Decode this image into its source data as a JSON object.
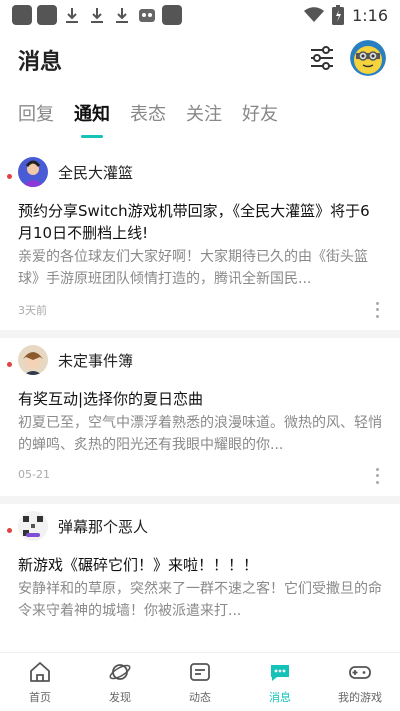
{
  "status_bar": {
    "time": "1:16"
  },
  "header": {
    "title": "消息"
  },
  "tabs": [
    {
      "label": "回复",
      "active": false
    },
    {
      "label": "通知",
      "active": true
    },
    {
      "label": "表态",
      "active": false
    },
    {
      "label": "关注",
      "active": false
    },
    {
      "label": "好友",
      "active": false
    }
  ],
  "notifications": [
    {
      "sender": "全民大灌篮",
      "title": "预约分享Switch游戏机带回家，《全民大灌篮》将于6月10日不删档上线!",
      "body": "亲爱的各位球友们大家好啊！大家期待已久的由《街头篮球》手游原班团队倾情打造的，腾讯全新国民...",
      "date": "3天前",
      "unread": true
    },
    {
      "sender": "未定事件簿",
      "title": "有奖互动|选择你的夏日恋曲",
      "body": "初夏已至，空气中漂浮着熟悉的浪漫味道。微热的风、轻悄的蝉鸣、炙热的阳光还有我眼中耀眼的你...",
      "date": "05-21",
      "unread": true
    },
    {
      "sender": "弹幕那个恶人",
      "title": "新游戏《碾碎它们！》来啦！！！！",
      "body": "安静祥和的草原，突然来了一群不速之客！它们受撒旦的命令来守着神的城墙！你被派遣来打...",
      "date": "",
      "unread": true
    }
  ],
  "bottom_nav": [
    {
      "label": "首页",
      "icon": "home-icon",
      "active": false
    },
    {
      "label": "发现",
      "icon": "planet-icon",
      "active": false
    },
    {
      "label": "动态",
      "icon": "feed-icon",
      "active": false
    },
    {
      "label": "消息",
      "icon": "message-icon",
      "active": true
    },
    {
      "label": "我的游戏",
      "icon": "gamepad-icon",
      "active": false
    }
  ],
  "colors": {
    "accent": "#14c2b8",
    "unread": "#e04343"
  }
}
